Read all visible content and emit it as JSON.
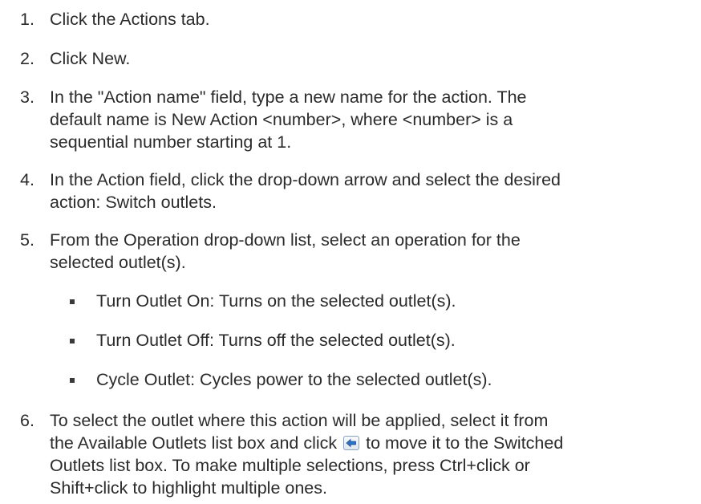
{
  "steps": [
    {
      "num": "1.",
      "lines": [
        "Click the Actions tab."
      ]
    },
    {
      "num": "2.",
      "lines": [
        "Click New."
      ]
    },
    {
      "num": "3.",
      "lines": [
        "In the \"Action name\" field, type a new name for the action. The",
        "default name is New Action <number>, where <number> is a",
        "sequential number starting at 1."
      ]
    },
    {
      "num": "4.",
      "lines": [
        "In the Action field, click the drop-down arrow and select the desired",
        "action: Switch outlets."
      ]
    },
    {
      "num": "5.",
      "lines": [
        "From the Operation drop-down list, select an operation for the",
        "selected outlet(s)."
      ]
    },
    {
      "num": "6.",
      "line1_before_icon": "To select the outlet where this action will be applied, select it from",
      "line2_before_icon": "the Available Outlets list box and click",
      "line2_after_icon": "to move it to the Switched",
      "rest_lines": [
        "Outlets list box. To make multiple selections, press Ctrl+click or",
        "Shift+click to highlight multiple ones."
      ]
    }
  ],
  "sub_items": [
    "Turn Outlet On: Turns on the selected outlet(s).",
    "Turn Outlet Off: Turns off the selected outlet(s).",
    "Cycle Outlet: Cycles power to the selected outlet(s)."
  ],
  "icons": {
    "move_button": "move-left-arrow-icon"
  }
}
